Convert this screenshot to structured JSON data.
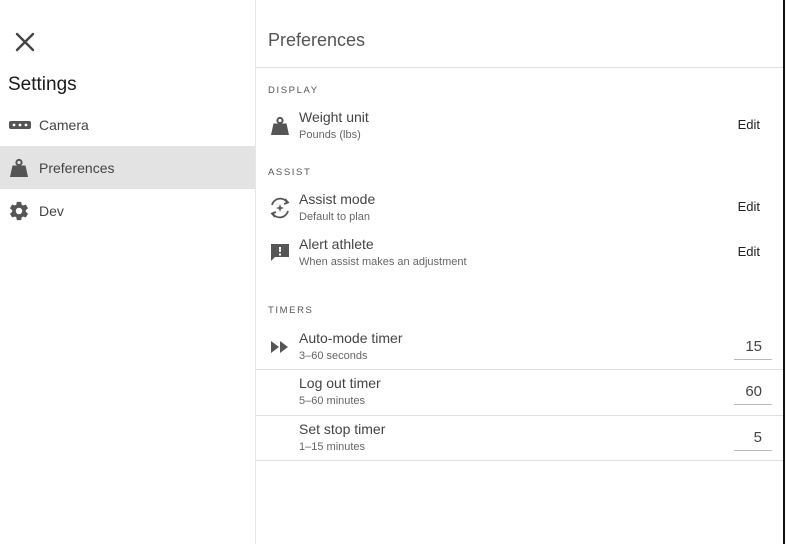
{
  "sidebar": {
    "title": "Settings",
    "close_icon": "close-icon",
    "items": [
      {
        "label": "Camera",
        "icon": "camera-icon",
        "active": false
      },
      {
        "label": "Preferences",
        "icon": "weight-icon",
        "active": true
      },
      {
        "label": "Dev",
        "icon": "gear-icon",
        "active": false
      }
    ]
  },
  "main": {
    "title": "Preferences",
    "sections": {
      "display": {
        "label": "DISPLAY",
        "weight_unit": {
          "title": "Weight unit",
          "subtitle": "Pounds (lbs)",
          "action": "Edit",
          "icon": "weight-icon"
        }
      },
      "assist": {
        "label": "ASSIST",
        "assist_mode": {
          "title": "Assist mode",
          "subtitle": "Default to plan",
          "action": "Edit",
          "icon": "assist-icon"
        },
        "alert_athlete": {
          "title": "Alert athlete",
          "subtitle": "When assist makes an adjustment",
          "action": "Edit",
          "icon": "alert-message-icon"
        }
      },
      "timers": {
        "label": "TIMERS",
        "auto_mode": {
          "title": "Auto-mode timer",
          "subtitle": "3–60 seconds",
          "value": "15",
          "icon": "fast-forward-icon"
        },
        "log_out": {
          "title": "Log out timer",
          "subtitle": "5–60 minutes",
          "value": "60"
        },
        "set_stop": {
          "title": "Set stop timer",
          "subtitle": "1–15 minutes",
          "value": "5"
        }
      }
    }
  },
  "colors": {
    "active_nav_bg": "#e3e3e3",
    "divider": "#e0e0e0",
    "icon": "#555555"
  }
}
